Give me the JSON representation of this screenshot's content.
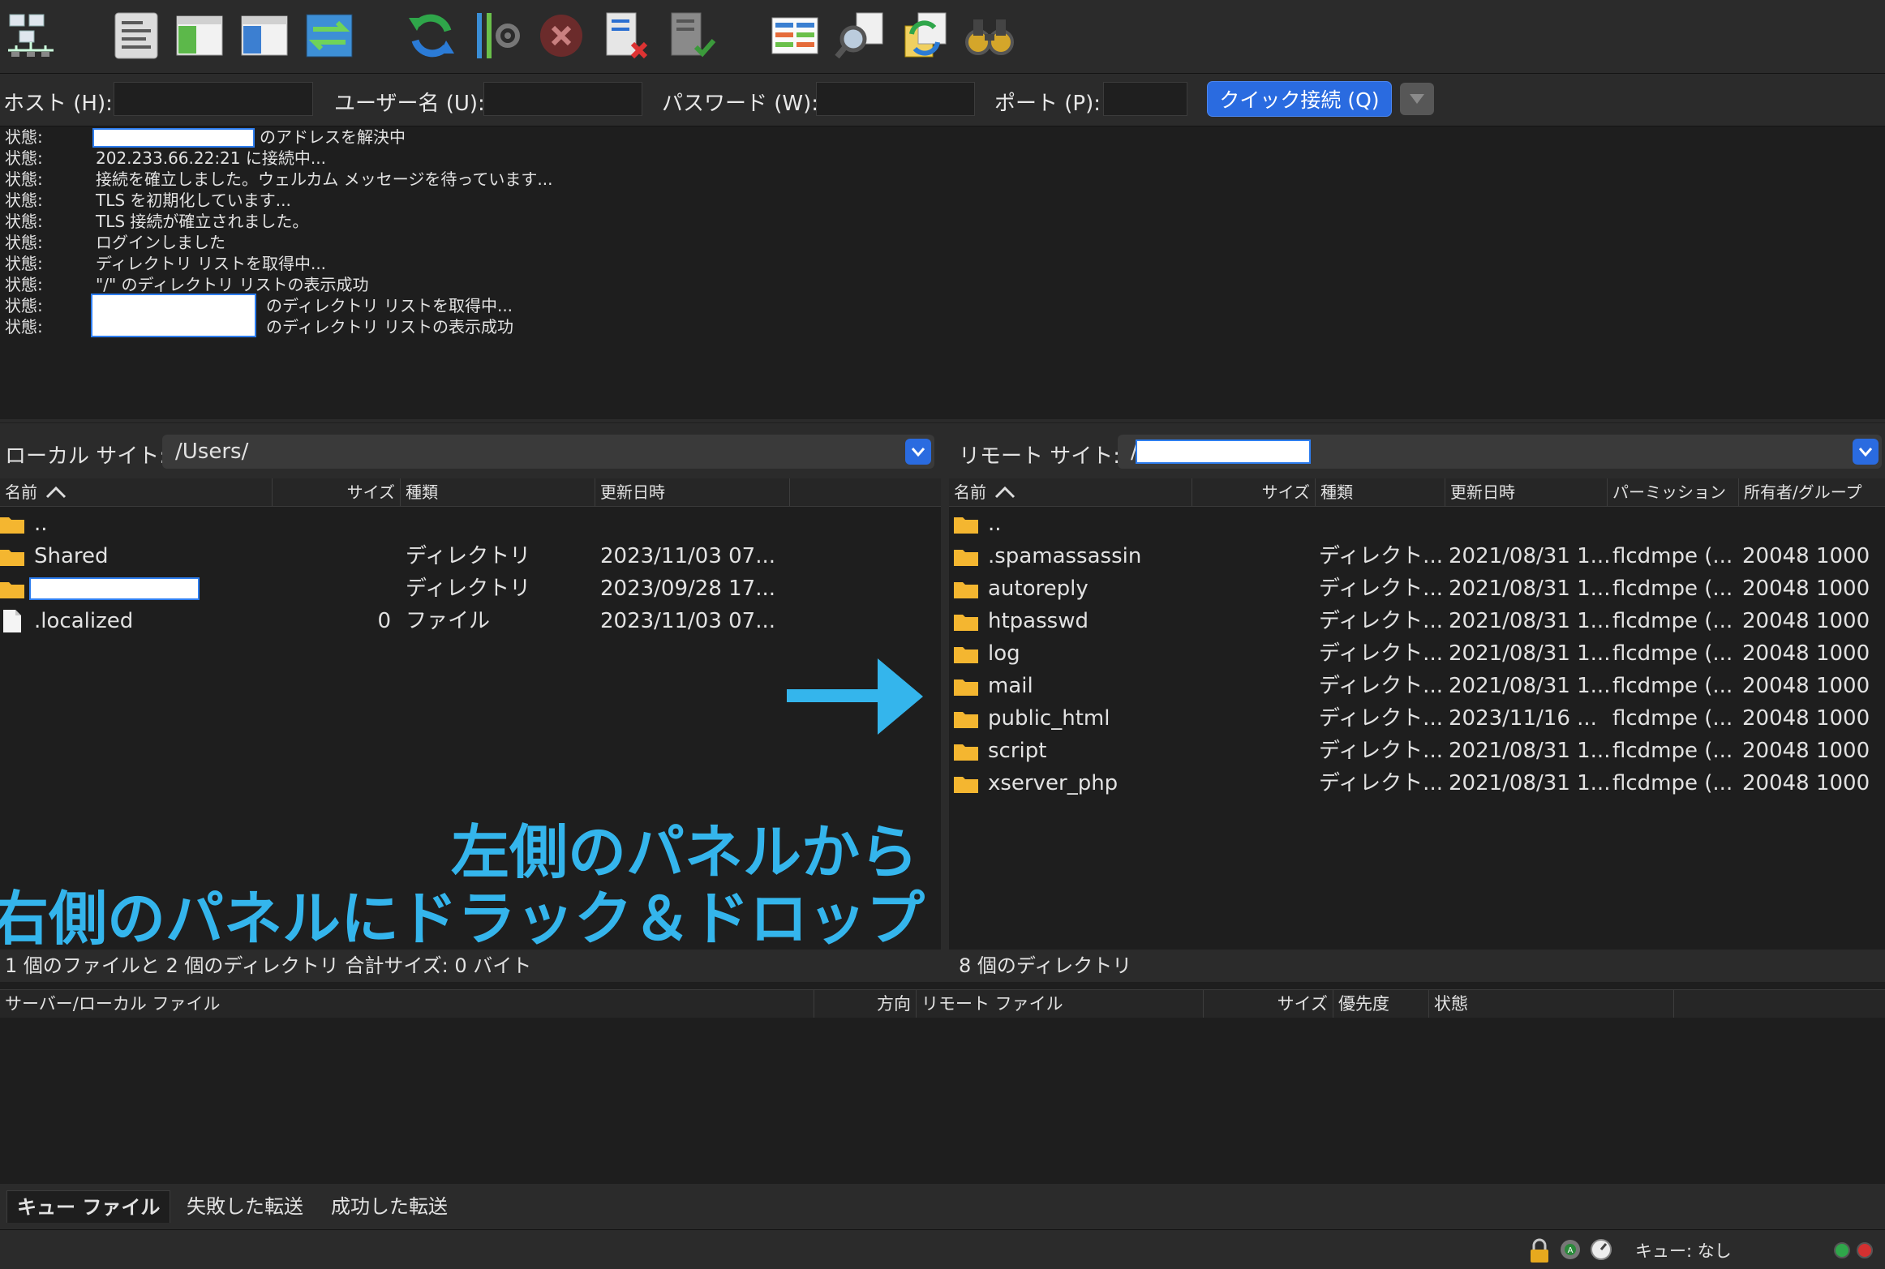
{
  "toolbar": {
    "icons": [
      "site-manager-icon",
      "message-log-icon",
      "local-tree-icon",
      "remote-tree-icon",
      "transfer-queue-icon",
      "refresh-icon",
      "filter-processing-icon",
      "cancel-icon",
      "disconnect-icon",
      "reconnect-icon",
      "compare-icon",
      "search-remote-icon",
      "sync-browsing-icon",
      "find-files-icon"
    ]
  },
  "quickconnect": {
    "host_label": "ホスト (H):",
    "host_value": "",
    "user_label": "ユーザー名 (U):",
    "user_value": "",
    "pass_label": "パスワード (W):",
    "pass_value": "",
    "port_label": "ポート (P):",
    "port_value": "",
    "connect_button": "クイック接続 (Q)"
  },
  "log": [
    {
      "label": "状態:",
      "message": "のアドレスを解決中"
    },
    {
      "label": "状態:",
      "message": "202.233.66.22:21 に接続中..."
    },
    {
      "label": "状態:",
      "message": "接続を確立しました。ウェルカム メッセージを待っています..."
    },
    {
      "label": "状態:",
      "message": "TLS を初期化しています..."
    },
    {
      "label": "状態:",
      "message": "TLS 接続が確立されました。"
    },
    {
      "label": "状態:",
      "message": "ログインしました"
    },
    {
      "label": "状態:",
      "message": "ディレクトリ リストを取得中..."
    },
    {
      "label": "状態:",
      "message": "\"/\" のディレクトリ リストの表示成功"
    },
    {
      "label": "状態:",
      "message": "のディレクトリ リストを取得中..."
    },
    {
      "label": "状態:",
      "message": "のディレクトリ リストの表示成功"
    }
  ],
  "local": {
    "site_label": "ローカル サイト:",
    "path": "/Users/",
    "columns": [
      "名前",
      "サイズ",
      "種類",
      "更新日時"
    ],
    "rows": [
      {
        "name": "..",
        "size": "",
        "type": "",
        "modified": ""
      },
      {
        "name": "Shared",
        "size": "",
        "type": "ディレクトリ",
        "modified": "2023/11/03 07..."
      },
      {
        "name": "",
        "size": "",
        "type": "ディレクトリ",
        "modified": "2023/09/28 17..."
      },
      {
        "name": ".localized",
        "size": "0",
        "type": "ファイル",
        "modified": "2023/11/03 07..."
      }
    ],
    "status": "1 個のファイルと 2 個のディレクトリ 合計サイズ: 0 バイト"
  },
  "remote": {
    "site_label": "リモート サイト:",
    "path": "/",
    "columns": [
      "名前",
      "サイズ",
      "種類",
      "更新日時",
      "パーミッション",
      "所有者/グループ"
    ],
    "rows": [
      {
        "name": "..",
        "size": "",
        "type": "",
        "modified": "",
        "perm": "",
        "owner": ""
      },
      {
        "name": ".spamassassin",
        "size": "",
        "type": "ディレクト...",
        "modified": "2021/08/31 1...",
        "perm": "flcdmpe (...",
        "owner": "20048 1000"
      },
      {
        "name": "autoreply",
        "size": "",
        "type": "ディレクト...",
        "modified": "2021/08/31 1...",
        "perm": "flcdmpe (...",
        "owner": "20048 1000"
      },
      {
        "name": "htpasswd",
        "size": "",
        "type": "ディレクト...",
        "modified": "2021/08/31 1...",
        "perm": "flcdmpe (...",
        "owner": "20048 1000"
      },
      {
        "name": "log",
        "size": "",
        "type": "ディレクト...",
        "modified": "2021/08/31 1...",
        "perm": "flcdmpe (...",
        "owner": "20048 1000"
      },
      {
        "name": "mail",
        "size": "",
        "type": "ディレクト...",
        "modified": "2021/08/31 1...",
        "perm": "flcdmpe (...",
        "owner": "20048 1000"
      },
      {
        "name": "public_html",
        "size": "",
        "type": "ディレクト...",
        "modified": "2023/11/16 ...",
        "perm": "flcdmpe (...",
        "owner": "20048 1000"
      },
      {
        "name": "script",
        "size": "",
        "type": "ディレクト...",
        "modified": "2021/08/31 1...",
        "perm": "flcdmpe (...",
        "owner": "20048 1000"
      },
      {
        "name": "xserver_php",
        "size": "",
        "type": "ディレクト...",
        "modified": "2021/08/31 1...",
        "perm": "flcdmpe (...",
        "owner": "20048 1000"
      }
    ],
    "status": "8 個のディレクトリ"
  },
  "overlay": {
    "line1": "左側のパネルから",
    "line2": "右側のパネルにドラック＆ドロップ",
    "color": "#34b5ec"
  },
  "queue": {
    "columns": [
      "サーバー/ローカル ファイル",
      "方向",
      "リモート ファイル",
      "サイズ",
      "優先度",
      "状態"
    ],
    "tabs": [
      "キュー ファイル",
      "失敗した転送",
      "成功した転送"
    ],
    "status": "キュー: なし"
  },
  "colors": {
    "accent": "#2a6be0",
    "folder": "#f4b630",
    "overlay": "#34b5ec"
  }
}
